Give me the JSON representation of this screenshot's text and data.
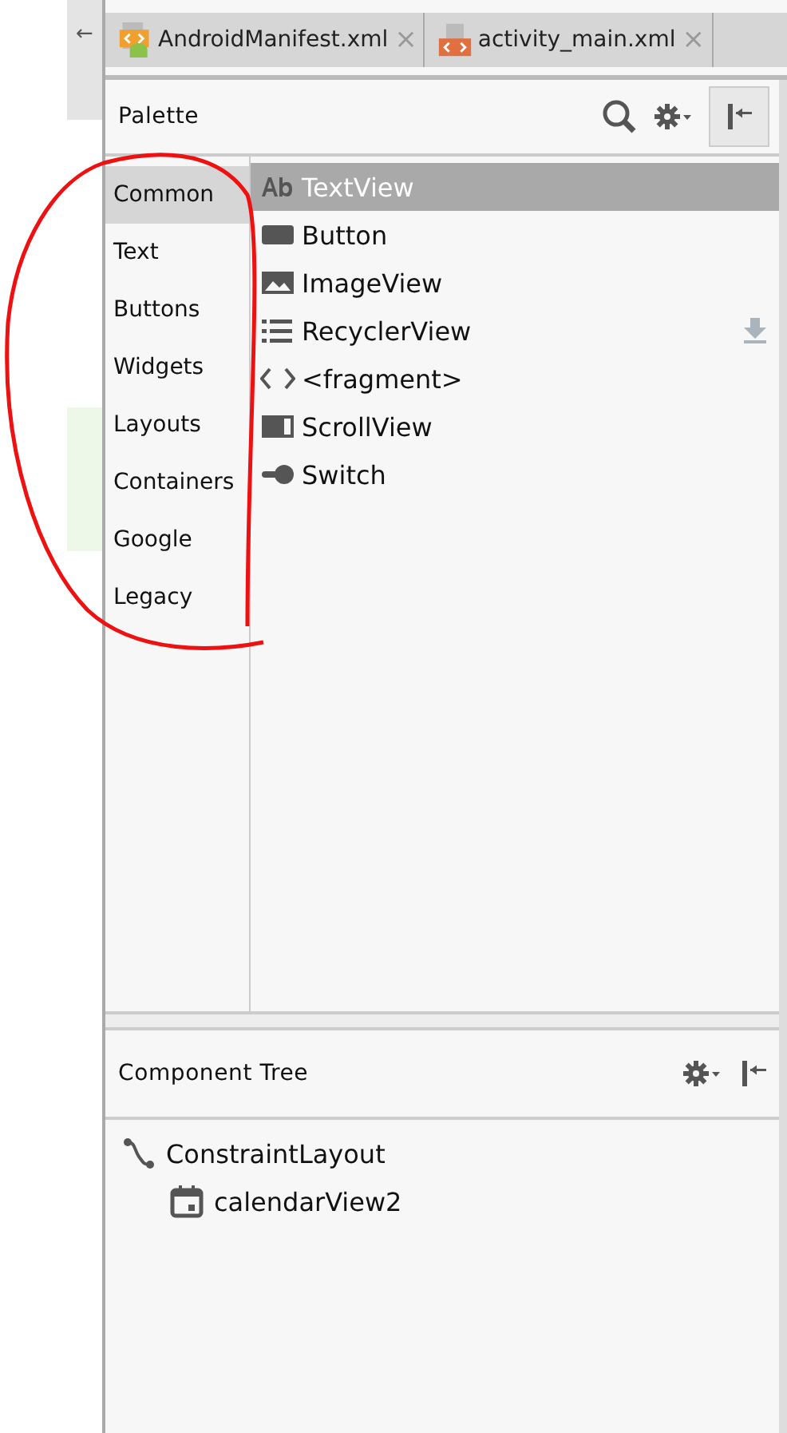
{
  "back_arrow": "←",
  "tabs": [
    {
      "label": "AndroidManifest.xml",
      "close": "×"
    },
    {
      "label": "activity_main.xml",
      "close": "×"
    }
  ],
  "palette": {
    "title": "Palette",
    "categories": [
      {
        "label": "Common",
        "selected": true
      },
      {
        "label": "Text",
        "selected": false
      },
      {
        "label": "Buttons",
        "selected": false
      },
      {
        "label": "Widgets",
        "selected": false
      },
      {
        "label": "Layouts",
        "selected": false
      },
      {
        "label": "Containers",
        "selected": false
      },
      {
        "label": "Google",
        "selected": false
      },
      {
        "label": "Legacy",
        "selected": false
      }
    ],
    "items": [
      {
        "label": "TextView",
        "kind": "text",
        "selected": true,
        "download": false
      },
      {
        "label": "Button",
        "kind": "button",
        "selected": false,
        "download": false
      },
      {
        "label": "ImageView",
        "kind": "image",
        "selected": false,
        "download": false
      },
      {
        "label": "RecyclerView",
        "kind": "list",
        "selected": false,
        "download": true
      },
      {
        "label": "<fragment>",
        "kind": "code",
        "selected": false,
        "download": false
      },
      {
        "label": "ScrollView",
        "kind": "scroll",
        "selected": false,
        "download": false
      },
      {
        "label": "Switch",
        "kind": "switch",
        "selected": false,
        "download": false
      }
    ]
  },
  "component_tree": {
    "title": "Component Tree",
    "nodes": [
      {
        "label": "ConstraintLayout",
        "kind": "constraint",
        "children": [
          {
            "label": "calendarView2",
            "kind": "calendar"
          }
        ]
      }
    ]
  }
}
